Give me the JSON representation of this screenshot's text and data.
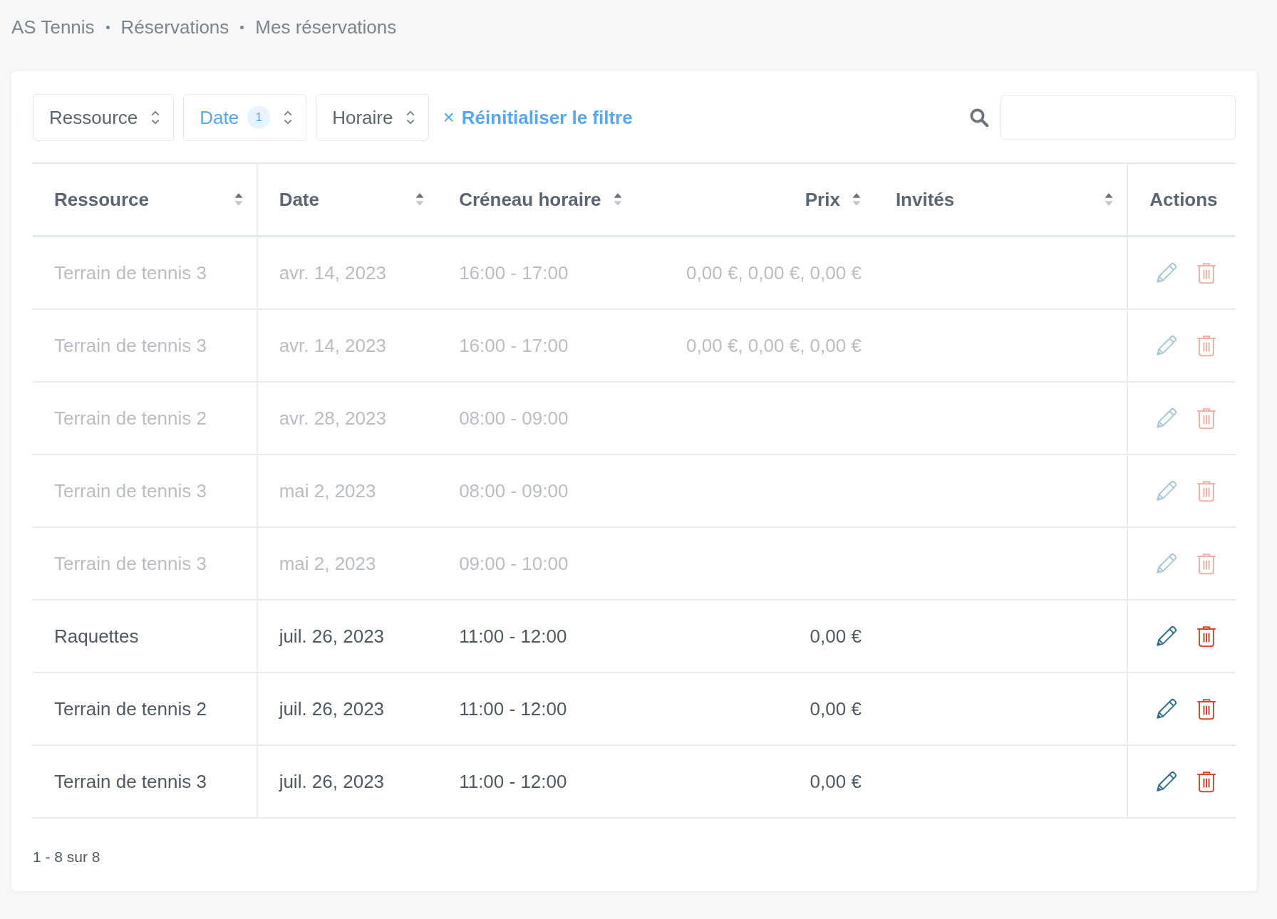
{
  "breadcrumb": [
    "AS Tennis",
    "Réservations",
    "Mes réservations"
  ],
  "filters": [
    {
      "label": "Ressource",
      "active": false
    },
    {
      "label": "Date",
      "count": "1",
      "active": true
    },
    {
      "label": "Horaire",
      "active": false
    }
  ],
  "reset_filter": {
    "icon": "×",
    "label": "Réinitialiser le filtre"
  },
  "table": {
    "columns": [
      {
        "label": "Ressource",
        "sortable": true
      },
      {
        "label": "Date",
        "sortable": true
      },
      {
        "label": "Créneau horaire",
        "sortable": true
      },
      {
        "label": "Prix",
        "sortable": true
      },
      {
        "label": "Invités",
        "sortable": true
      },
      {
        "label": "Actions",
        "sortable": false
      }
    ],
    "rows": [
      {
        "resource": "Terrain de tennis 3",
        "date": "avr. 14, 2023",
        "slot": "16:00 - 17:00",
        "price": "0,00 €, 0,00 €, 0,00 €",
        "past": true
      },
      {
        "resource": "Terrain de tennis 3",
        "date": "avr. 14, 2023",
        "slot": "16:00 - 17:00",
        "price": "0,00 €, 0,00 €, 0,00 €",
        "past": true
      },
      {
        "resource": "Terrain de tennis 2",
        "date": "avr. 28, 2023",
        "slot": "08:00 - 09:00",
        "past": true
      },
      {
        "resource": "Terrain de tennis 3",
        "date": "mai 2, 2023",
        "slot": "08:00 - 09:00",
        "past": true
      },
      {
        "resource": "Terrain de tennis 3",
        "date": "mai 2, 2023",
        "slot": "09:00 - 10:00",
        "past": true
      },
      {
        "resource": "Raquettes",
        "date": "juil. 26, 2023",
        "slot": "11:00 - 12:00",
        "price": "0,00 €",
        "past": false
      },
      {
        "resource": "Terrain de tennis 2",
        "date": "juil. 26, 2023",
        "slot": "11:00 - 12:00",
        "price": "0,00 €",
        "past": false
      },
      {
        "resource": "Terrain de tennis 3",
        "date": "juil. 26, 2023",
        "slot": "11:00 - 12:00",
        "price": "0,00 €",
        "past": false
      }
    ]
  },
  "pagination": "1 - 8 sur 8"
}
